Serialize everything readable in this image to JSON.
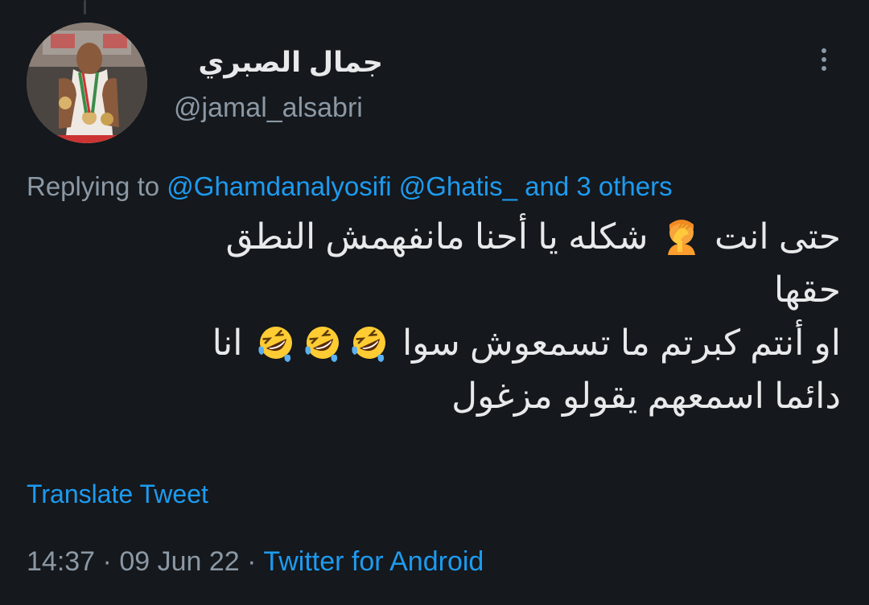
{
  "tweet": {
    "display_name": "جمال الصبري",
    "handle": "@jamal_alsabri",
    "more_icon": "more-vertical-icon",
    "reply": {
      "prefix": "Replying to",
      "mention_1": "@Ghamdanalyosifi",
      "mention_2": "@Ghatis_",
      "others": "and 3 others"
    },
    "body": {
      "line1_a": "حتى انت",
      "line1_b": "شكله يا أحنا مانفهمش النطق",
      "line2": "حقها",
      "line3_a": "او أنتم كبرتم ما تسمعوش سوا",
      "line3_b": "انا",
      "line4": "دائما اسمعهم يقولو مزغول"
    },
    "translate_label": "Translate Tweet",
    "time": "14:37",
    "sep_1": "·",
    "date": "09 Jun 22",
    "sep_2": "·",
    "source": "Twitter for Android"
  },
  "colors": {
    "background": "#15181c",
    "text": "#e7e9ea",
    "muted": "#8b98a5",
    "link": "#1d9bf0"
  },
  "icons": [
    "face-palm-emoji-icon",
    "rolling-laughing-emoji-icon"
  ]
}
